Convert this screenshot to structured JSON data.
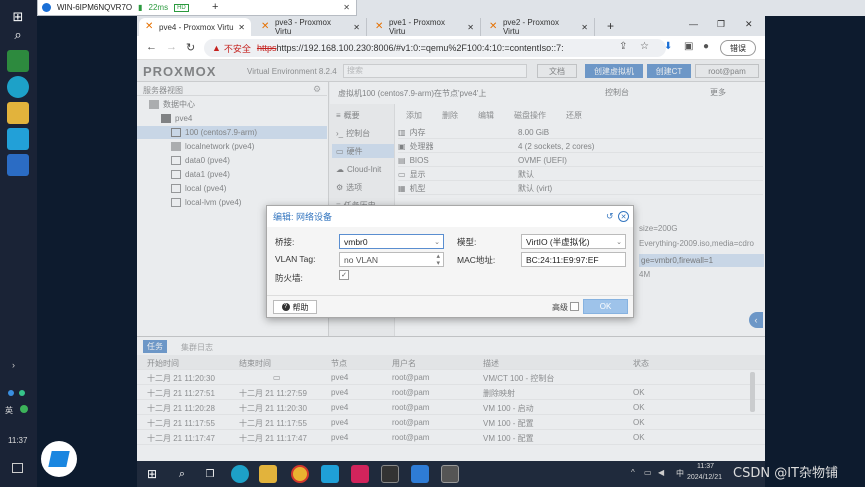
{
  "remote": {
    "title": "WIN-6IPM6NQVR7O",
    "ping": "22ms"
  },
  "browser": {
    "tabs": [
      {
        "label": "pve4 - Proxmox Virtu"
      },
      {
        "label": "pve3 - Proxmox Virtu"
      },
      {
        "label": "pve1 - Proxmox Virtu"
      },
      {
        "label": "pve2 - Proxmox Virtu"
      }
    ],
    "insecure_label": "不安全",
    "url": "https://192.168.100.230:8006/#v1:0:=qemu%2F100:4:10:=contentIso::7:",
    "error_button": "错误"
  },
  "pve": {
    "logo": "PROXMOX",
    "product": "Virtual Environment 8.2.4",
    "search_placeholder": "搜索",
    "header_buttons": [
      "文档",
      "创建虚拟机",
      "创建CT",
      "root@pam"
    ],
    "server_view": "服务器视图",
    "tree": [
      {
        "label": "数据中心"
      },
      {
        "label": "pve4"
      },
      {
        "label": "100 (centos7.9-arm)"
      },
      {
        "label": "localnetwork (pve4)"
      },
      {
        "label": "data0 (pve4)"
      },
      {
        "label": "data1 (pve4)"
      },
      {
        "label": "local (pve4)"
      },
      {
        "label": "local-lvm (pve4)"
      }
    ],
    "vm_title": "虚拟机100 (centos7.9-arm)在节点'pve4'上",
    "vm_actions": [
      "控制台",
      "更多"
    ],
    "submenu": [
      {
        "label": "概要"
      },
      {
        "label": "控制台"
      },
      {
        "label": "硬件"
      },
      {
        "label": "Cloud-Init"
      },
      {
        "label": "选项"
      },
      {
        "label": "任务历史"
      }
    ],
    "hw_toolbar": [
      "添加",
      "删除",
      "编辑",
      "磁盘操作",
      "还原"
    ],
    "hardware": [
      {
        "key": "内存",
        "value": "8.00 GiB"
      },
      {
        "key": "处理器",
        "value": "4 (2 sockets, 2 cores)"
      },
      {
        "key": "BIOS",
        "value": "OVMF (UEFI)"
      },
      {
        "key": "显示",
        "value": "默认"
      },
      {
        "key": "机型",
        "value": "默认 (virt)"
      }
    ],
    "hw_partial": [
      "size=200G",
      "Everything-2009.iso,media=cdro",
      "ge=vmbr0,firewall=1",
      "4M"
    ]
  },
  "dialog": {
    "title": "编辑: 网络设备",
    "bridge_label": "桥接:",
    "bridge_value": "vmbr0",
    "vlan_label": "VLAN Tag:",
    "vlan_value": "no VLAN",
    "firewall_label": "防火墙:",
    "model_label": "模型:",
    "model_value": "VirtIO (半虚拟化)",
    "mac_label": "MAC地址:",
    "mac_value": "BC:24:11:E9:97:EF",
    "help_label": "帮助",
    "advanced_label": "高级",
    "ok_label": "OK"
  },
  "log": {
    "tabs": [
      "任务",
      "集群日志"
    ],
    "columns": [
      "开始时间",
      "结束时间",
      "节点",
      "用户名",
      "描述",
      "状态"
    ],
    "rows": [
      {
        "start": "十二月 21 11:20:30",
        "end": "",
        "node": "pve4",
        "user": "root@pam",
        "desc": "VM/CT 100 - 控制台",
        "status": ""
      },
      {
        "start": "十二月 21 11:27:51",
        "end": "十二月 21 11:27:59",
        "node": "pve4",
        "user": "root@pam",
        "desc": "删除映射",
        "status": "OK"
      },
      {
        "start": "十二月 21 11:20:28",
        "end": "十二月 21 11:20:30",
        "node": "pve4",
        "user": "root@pam",
        "desc": "VM 100 - 启动",
        "status": "OK"
      },
      {
        "start": "十二月 21 11:17:55",
        "end": "十二月 21 11:17:55",
        "node": "pve4",
        "user": "root@pam",
        "desc": "VM 100 - 配置",
        "status": "OK"
      },
      {
        "start": "十二月 21 11:17:47",
        "end": "十二月 21 11:17:47",
        "node": "pve4",
        "user": "root@pam",
        "desc": "VM 100 - 配置",
        "status": "OK"
      }
    ]
  },
  "host": {
    "time": "11:37",
    "ime": "英"
  },
  "taskbar": {
    "time": "11:37",
    "date": "2024/12/21",
    "ime": "中"
  },
  "watermark": "CSDN @IT杂物铺"
}
